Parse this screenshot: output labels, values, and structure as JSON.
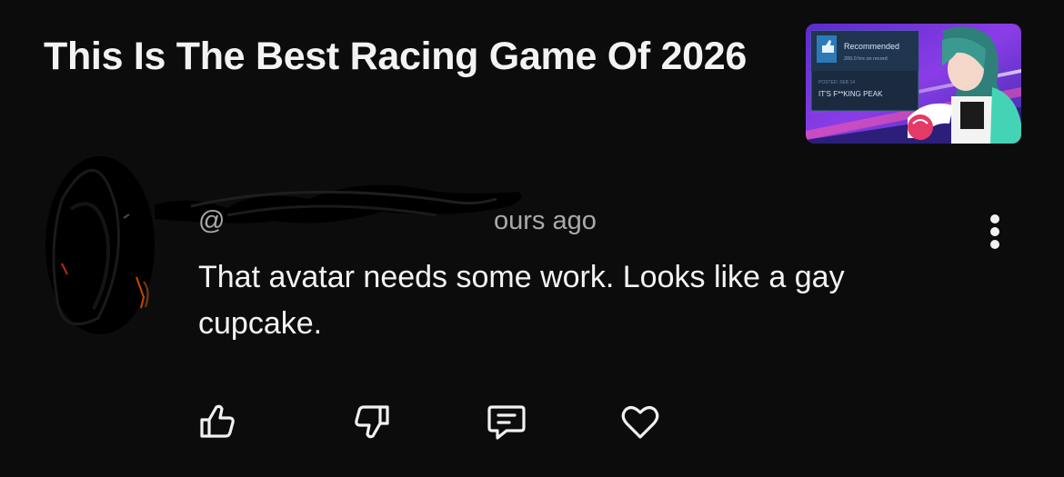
{
  "video": {
    "title": "This Is The Best Racing Game Of 2026",
    "thumbnail": {
      "card_heading": "Recommended",
      "card_hours": "200.0 hrs on record",
      "card_posted": "POSTED: FEB 14",
      "card_review": "IT'S F**KING PEAK"
    }
  },
  "comment": {
    "handle": "@",
    "time_ago": "ours ago",
    "text": "That avatar needs some work. Looks like a gay cupcake."
  },
  "actions": {
    "icons": [
      "thumbs-up-icon",
      "thumbs-down-icon",
      "reply-icon",
      "heart-icon"
    ]
  },
  "colors": {
    "background": "#0c0c0d",
    "text_primary": "#f3f3f3",
    "text_secondary": "#aaaaaa",
    "thumb_card": "#1b2a3e"
  }
}
